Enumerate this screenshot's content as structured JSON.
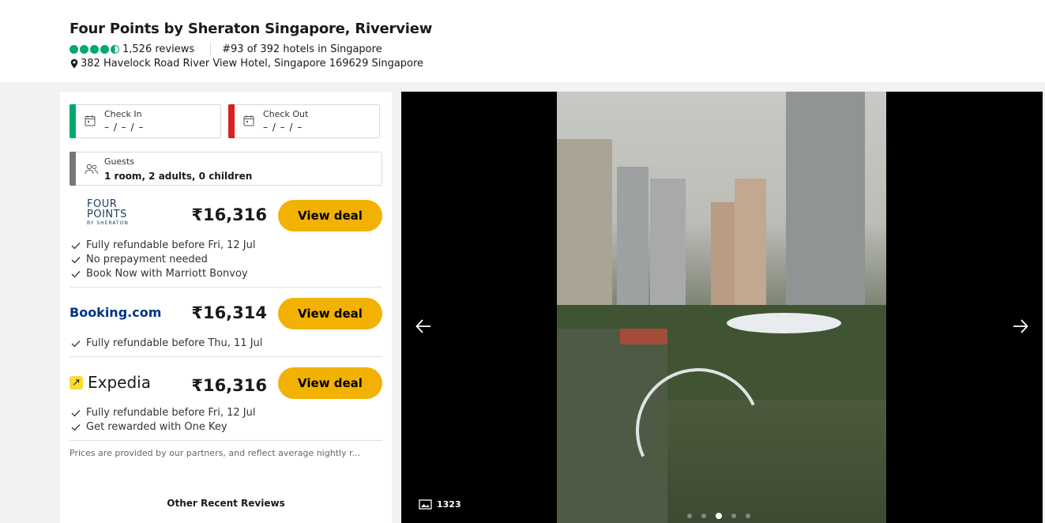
{
  "hotel": {
    "name": "Four Points by Sheraton Singapore, Riverview",
    "rating": 4.5,
    "reviews": "1,526 reviews",
    "rank": "#93 of 392 hotels in Singapore",
    "address": "382 Havelock Road River View Hotel, Singapore 169629 Singapore"
  },
  "booking": {
    "check_in_label": "Check In",
    "check_in_value": "– / – / –",
    "check_out_label": "Check Out",
    "check_out_value": "– / – / –",
    "guests_label": "Guests",
    "guests_value": "1 room, 2 adults, 0 children"
  },
  "deals": [
    {
      "provider": "FOUR POINTS BY SHERATON",
      "logo_lines": [
        "FOUR",
        "POINTS",
        "BY SHERATON"
      ],
      "price": "₹16,316",
      "button": "View deal",
      "perks": [
        "Fully refundable before Fri, 12 Jul",
        "No prepayment needed",
        "Book Now with Marriott Bonvoy"
      ]
    },
    {
      "provider": "Booking.com",
      "price": "₹16,314",
      "button": "View deal",
      "perks": [
        "Fully refundable before Thu, 11 Jul"
      ]
    },
    {
      "provider": "Expedia",
      "price": "₹16,316",
      "button": "View deal",
      "perks": [
        "Fully refundable before Fri, 12 Jul",
        "Get rewarded with One Key"
      ]
    }
  ],
  "disclaimer": "Prices are provided by our partners, and reflect average nightly r...",
  "recent_reviews_heading": "Other Recent Reviews",
  "gallery": {
    "photo_count": "1323",
    "dots": 5,
    "active_dot": 2
  },
  "colors": {
    "rating_green": "#00aa6c",
    "cta_yellow": "#f2b203",
    "check_in_bar": "#00aa6c",
    "check_out_bar": "#d91f1f",
    "guests_bar": "#777777",
    "booking_blue": "#003580"
  },
  "icons": [
    "map-pin-icon",
    "calendar-icon",
    "guests-icon",
    "check-icon",
    "arrow-left-icon",
    "arrow-right-icon",
    "image-icon"
  ]
}
